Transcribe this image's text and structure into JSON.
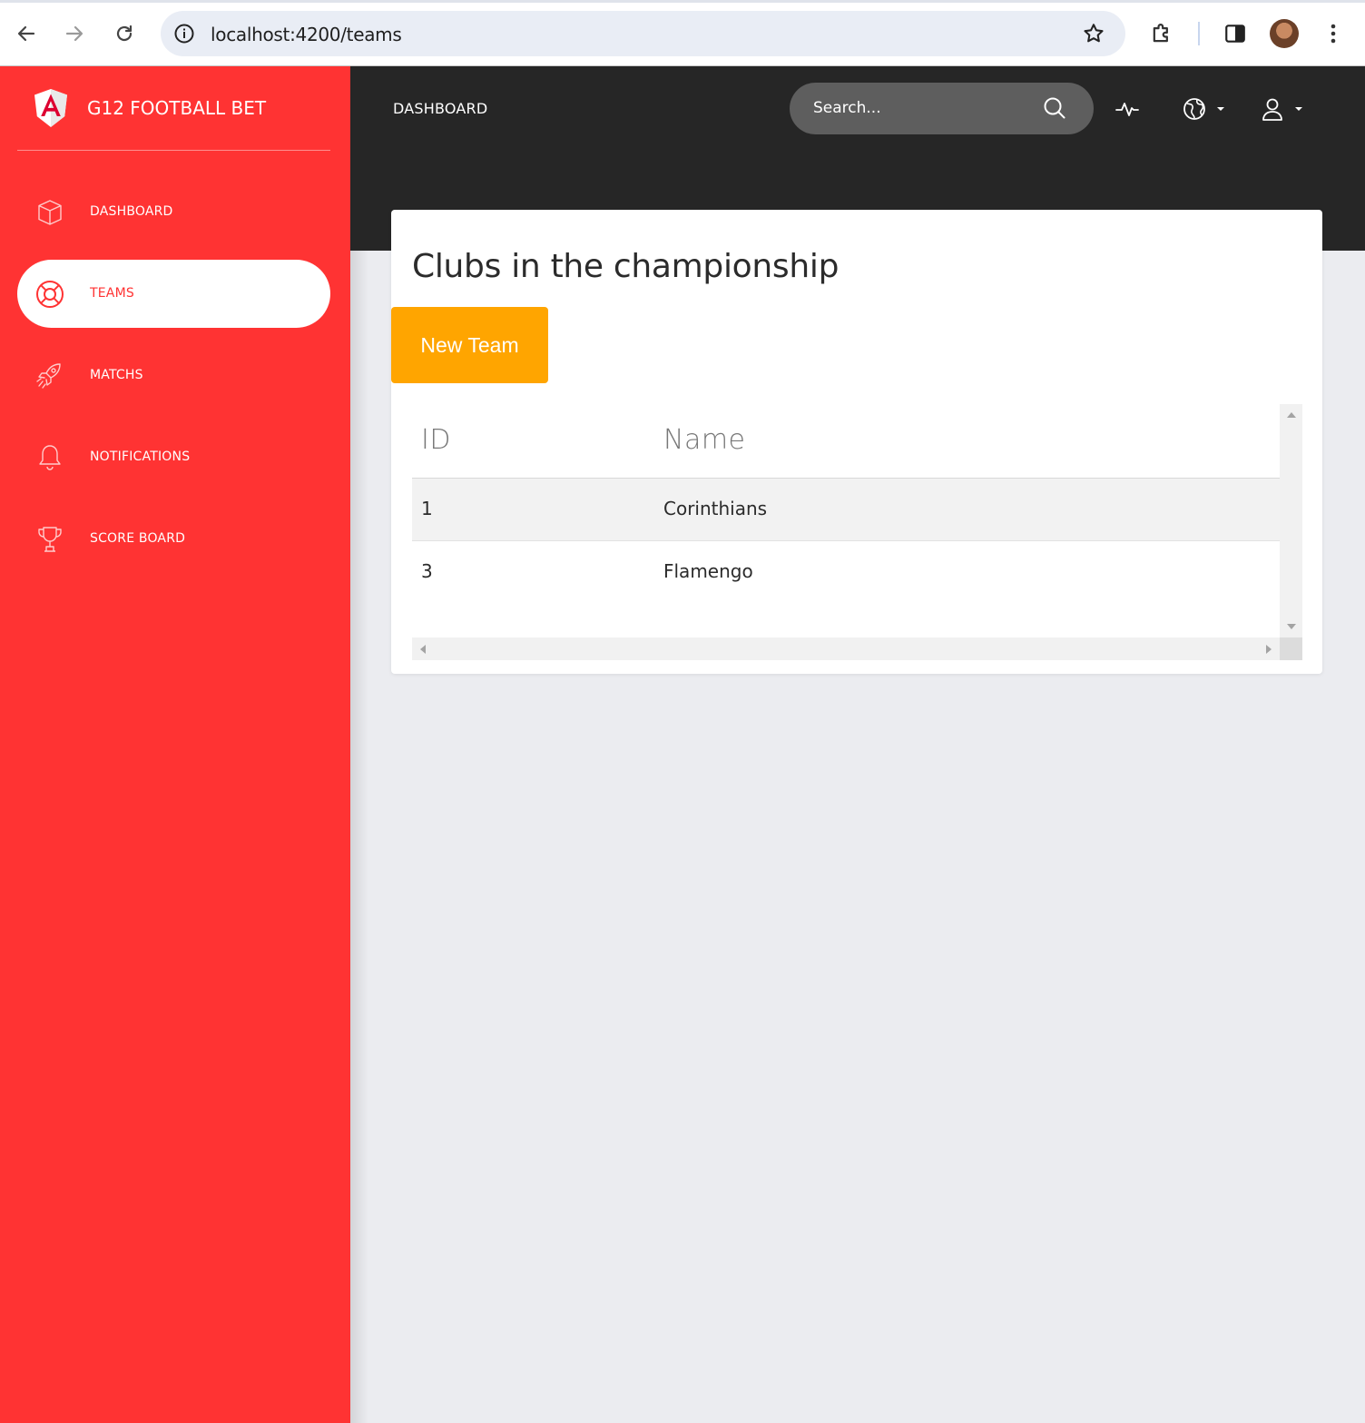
{
  "browser": {
    "url": "localhost:4200/teams"
  },
  "app": {
    "brand": "G12 FOOTBALL BET",
    "accent_color": "#ff3333",
    "topbar_color": "#262626",
    "button_color": "#ffa500"
  },
  "sidebar": {
    "items": [
      {
        "label": "DASHBOARD",
        "icon": "cube-icon",
        "active": false
      },
      {
        "label": "TEAMS",
        "icon": "lifebuoy-icon",
        "active": true
      },
      {
        "label": "MATCHS",
        "icon": "rocket-icon",
        "active": false
      },
      {
        "label": "NOTIFICATIONS",
        "icon": "bell-icon",
        "active": false
      },
      {
        "label": "SCORE BOARD",
        "icon": "trophy-icon",
        "active": false
      }
    ]
  },
  "topbar": {
    "title": "DASHBOARD",
    "search_placeholder": "Search...",
    "icons": [
      "activity-icon",
      "globe-icon",
      "user-icon"
    ]
  },
  "main": {
    "title": "Clubs in the championship",
    "new_button": "New Team",
    "table": {
      "columns": [
        "ID",
        "Name"
      ],
      "rows": [
        {
          "id": "1",
          "name": "Corinthians"
        },
        {
          "id": "3",
          "name": "Flamengo"
        }
      ]
    }
  }
}
